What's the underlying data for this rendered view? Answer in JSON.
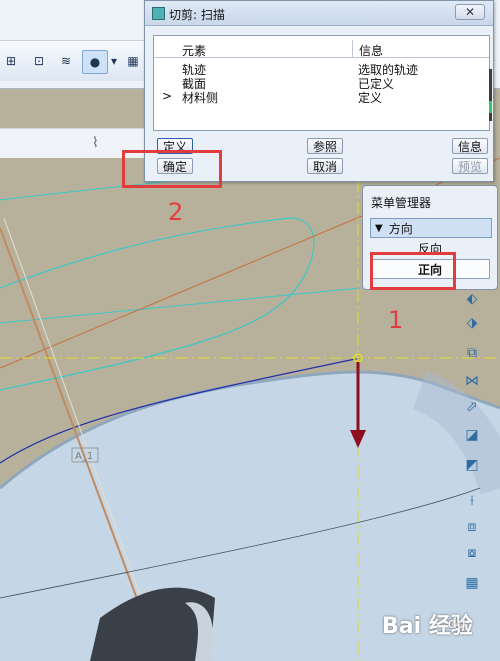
{
  "dialog": {
    "title": "切剪: 扫描",
    "close_glyph": "✕",
    "table": {
      "headers": [
        "元素",
        "信息"
      ],
      "rows": [
        {
          "prefix": "",
          "element": "轨迹",
          "info": "选取的轨迹"
        },
        {
          "prefix": "",
          "element": "截面",
          "info": "已定义"
        },
        {
          "prefix": ">",
          "element": "材料侧",
          "info": "定义"
        }
      ]
    },
    "buttons": {
      "define": "定义",
      "refs": "参照",
      "info": "信息",
      "ok": "确定",
      "cancel": "取消",
      "preview": "预览"
    }
  },
  "menu_manager": {
    "title": "菜单管理器",
    "header": "方向",
    "options": [
      "反向",
      "正向"
    ],
    "selected": "正向"
  },
  "annotations": {
    "step1": "1",
    "step2": "2"
  },
  "model_label": "A_1",
  "watermark": {
    "brand": "Bai 经验",
    "sub": "du"
  },
  "colors": {
    "annotation_red": "#e23c3c",
    "background_olive": "#b7b19c",
    "part_blue": "#c5d6e6",
    "dimension_yellow": "#e2dc2b",
    "arrow_maroon": "#8d0e1d"
  }
}
